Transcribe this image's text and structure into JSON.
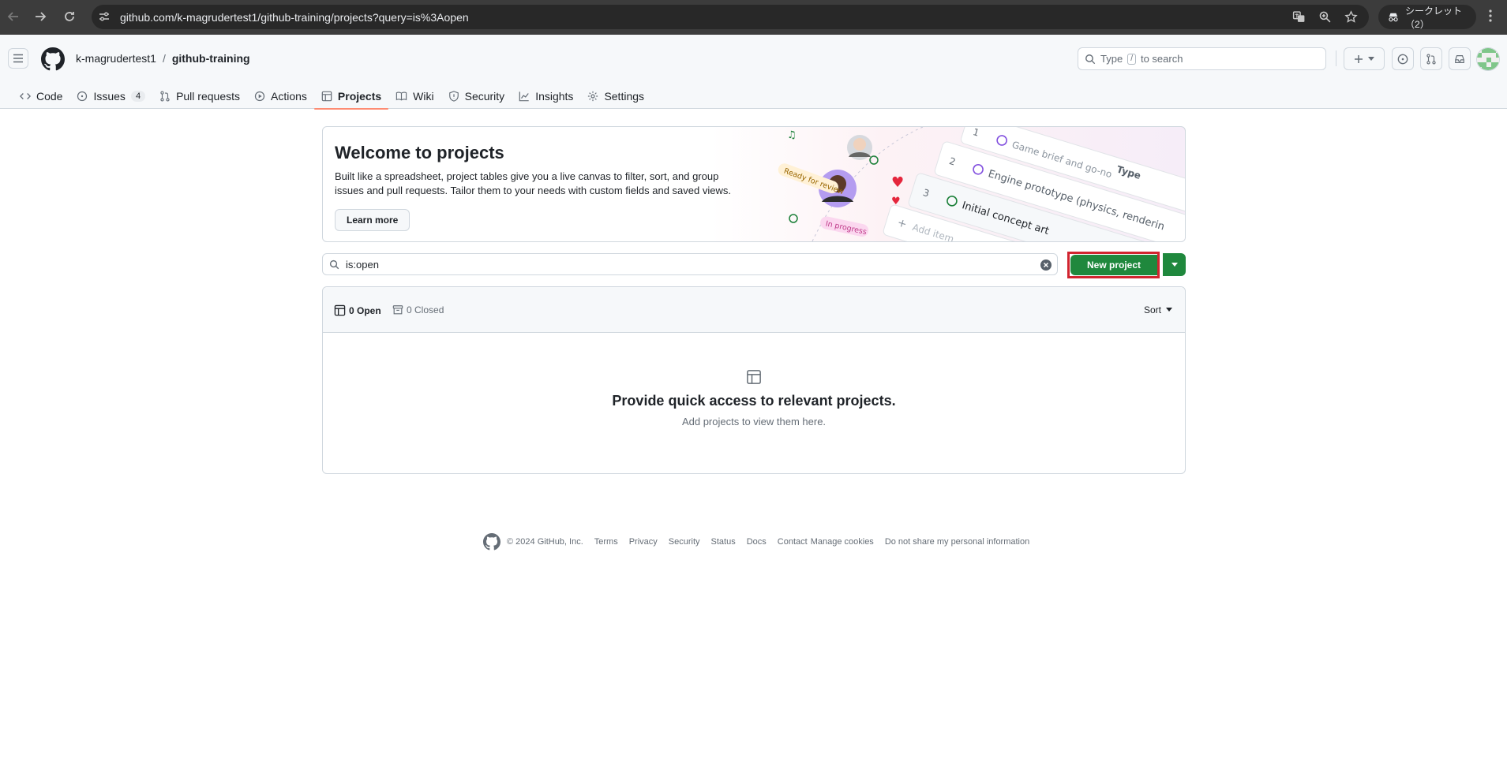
{
  "browser": {
    "url": "github.com/k-magrudertest1/github-training/projects?query=is%3Aopen",
    "profile_label": "シークレット（2）"
  },
  "header": {
    "owner": "k-magrudertest1",
    "separator": "/",
    "repo": "github-training",
    "search": {
      "prefix": "Type",
      "key": "/",
      "suffix": "to search"
    }
  },
  "tabs": [
    {
      "label": "Code",
      "icon": "code-icon"
    },
    {
      "label": "Issues",
      "icon": "issue-opened-icon",
      "count": "4"
    },
    {
      "label": "Pull requests",
      "icon": "git-pull-request-icon"
    },
    {
      "label": "Actions",
      "icon": "play-icon"
    },
    {
      "label": "Projects",
      "icon": "table-icon",
      "active": true
    },
    {
      "label": "Wiki",
      "icon": "book-icon"
    },
    {
      "label": "Security",
      "icon": "shield-icon"
    },
    {
      "label": "Insights",
      "icon": "graph-icon"
    },
    {
      "label": "Settings",
      "icon": "gear-icon"
    }
  ],
  "banner": {
    "title": "Welcome to projects",
    "text": "Built like a spreadsheet, project tables give you a live canvas to filter, sort, and group issues and pull requests. Tailor them to your needs with custom fields and saved views.",
    "learn_more": "Learn more",
    "art": {
      "row1_num": "1",
      "row1_text": "Game brief and go-no",
      "row2_num": "2",
      "row2_text": "Engine prototype (physics, renderin",
      "row3_num": "3",
      "row3_text": "Initial concept art",
      "add_item": "Add item",
      "tag_review": "Ready for review",
      "tag_progress": "In progress",
      "type_label": "Type"
    }
  },
  "filter": {
    "value": "is:open",
    "new_project": "New project"
  },
  "projects": {
    "open_label": "0 Open",
    "closed_label": "0 Closed",
    "sort_label": "Sort",
    "empty_title": "Provide quick access to relevant projects.",
    "empty_sub": "Add projects to view them here."
  },
  "footer": {
    "copyright": "© 2024 GitHub, Inc.",
    "links": [
      "Terms",
      "Privacy",
      "Security",
      "Status",
      "Docs",
      "Contact",
      "Manage cookies",
      "Do not share my personal information"
    ]
  },
  "colors": {
    "primary_green": "#1f883d",
    "highlight_red": "#d1242f",
    "tab_underline": "#fd8c73"
  }
}
